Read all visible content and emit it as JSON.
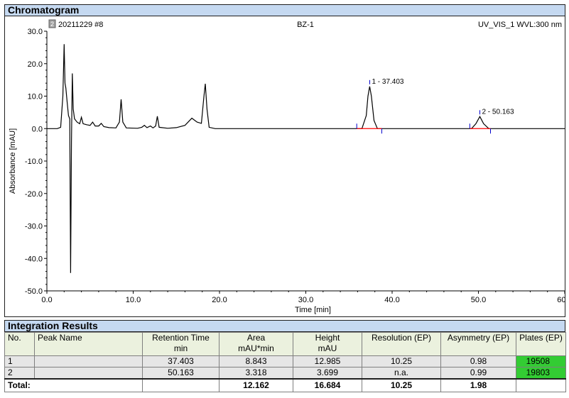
{
  "chromatogram": {
    "section_title": "Chromatogram",
    "header_left": "20211229 #8",
    "header_center": "BZ-1",
    "header_right": "UV_VIS_1 WVL:300 nm",
    "header_icon": "channel-icon"
  },
  "chart_data": {
    "type": "line",
    "title": "",
    "xlabel": "Time [min]",
    "ylabel": "Absorbance [mAU]",
    "xlim": [
      0,
      60
    ],
    "ylim": [
      -50,
      30
    ],
    "x_ticks": [
      "0.0",
      "10.0",
      "20.0",
      "30.0",
      "40.0",
      "50.0",
      "60.0"
    ],
    "y_ticks": [
      "30.0",
      "20.0",
      "10.0",
      "0.0",
      "-10.0",
      "-20.0",
      "-30.0",
      "-40.0",
      "-50.0"
    ],
    "grid": false,
    "line_color": "#000000",
    "baseline_color": "#ff0000",
    "marker_color": "#0000cc",
    "series": [
      {
        "points": [
          [
            0,
            0
          ],
          [
            1.2,
            0
          ],
          [
            1.6,
            0.4
          ],
          [
            1.85,
            10
          ],
          [
            2.0,
            26
          ],
          [
            2.1,
            14
          ],
          [
            2.2,
            12.5
          ],
          [
            2.35,
            8
          ],
          [
            2.5,
            4
          ],
          [
            2.65,
            3
          ],
          [
            2.75,
            -44.5
          ],
          [
            2.85,
            -4
          ],
          [
            2.95,
            17
          ],
          [
            3.05,
            6
          ],
          [
            3.2,
            3
          ],
          [
            3.5,
            2
          ],
          [
            3.8,
            1.5
          ],
          [
            4.0,
            3.5
          ],
          [
            4.2,
            1.5
          ],
          [
            4.6,
            1.2
          ],
          [
            5.0,
            1
          ],
          [
            5.3,
            2
          ],
          [
            5.6,
            0.8
          ],
          [
            6.0,
            0.8
          ],
          [
            6.3,
            1.6
          ],
          [
            6.6,
            0.6
          ],
          [
            7.2,
            0.3
          ],
          [
            8.0,
            0.2
          ],
          [
            8.4,
            2
          ],
          [
            8.6,
            9
          ],
          [
            8.8,
            2
          ],
          [
            9.2,
            0.2
          ],
          [
            10.5,
            0.1
          ],
          [
            11.0,
            0.4
          ],
          [
            11.3,
            1
          ],
          [
            11.6,
            0.3
          ],
          [
            12.0,
            0.8
          ],
          [
            12.3,
            0.2
          ],
          [
            12.6,
            0.8
          ],
          [
            12.8,
            3.8
          ],
          [
            13.0,
            0.4
          ],
          [
            14.0,
            0.1
          ],
          [
            15.0,
            0.3
          ],
          [
            16.0,
            1
          ],
          [
            16.8,
            3.2
          ],
          [
            17.4,
            2
          ],
          [
            17.9,
            1.6
          ],
          [
            18.2,
            10
          ],
          [
            18.35,
            13.8
          ],
          [
            18.55,
            6
          ],
          [
            18.8,
            0.4
          ],
          [
            19.5,
            0
          ],
          [
            25,
            0
          ],
          [
            30,
            0
          ],
          [
            35,
            0
          ],
          [
            36.5,
            0
          ],
          [
            37.0,
            4
          ],
          [
            37.2,
            10
          ],
          [
            37.4,
            12.985
          ],
          [
            37.6,
            10
          ],
          [
            37.9,
            2.5
          ],
          [
            38.3,
            0
          ],
          [
            45,
            0
          ],
          [
            49.2,
            0
          ],
          [
            49.7,
            1.5
          ],
          [
            50.163,
            3.699
          ],
          [
            50.6,
            1.5
          ],
          [
            51.2,
            0
          ],
          [
            55,
            0
          ],
          [
            60,
            0
          ]
        ]
      }
    ],
    "peaks": [
      {
        "number": "1",
        "retention": "37.403",
        "label": "1 - 37.403",
        "time": 37.403,
        "height": 12.985,
        "start": 35.9,
        "end": 38.8
      },
      {
        "number": "2",
        "retention": "50.163",
        "label": "2 - 50.163",
        "time": 50.163,
        "height": 3.699,
        "start": 49.0,
        "end": 51.4
      }
    ]
  },
  "integration": {
    "section_title": "Integration Results",
    "columns": [
      {
        "line1": "No.",
        "line2": ""
      },
      {
        "line1": "Peak Name",
        "line2": ""
      },
      {
        "line1": "Retention Time",
        "line2": "min"
      },
      {
        "line1": "Area",
        "line2": "mAU*min"
      },
      {
        "line1": "Height",
        "line2": "mAU"
      },
      {
        "line1": "Resolution (EP)",
        "line2": ""
      },
      {
        "line1": "Asymmetry (EP)",
        "line2": ""
      },
      {
        "line1": "Plates (EP)",
        "line2": ""
      }
    ],
    "rows": [
      {
        "no": "1",
        "peak_name": "",
        "retention": "37.403",
        "area": "8.843",
        "height": "12.985",
        "resolution": "10.25",
        "asymmetry": "0.98",
        "plates": "19508"
      },
      {
        "no": "2",
        "peak_name": "",
        "retention": "50.163",
        "area": "3.318",
        "height": "3.699",
        "resolution": "n.a.",
        "asymmetry": "0.99",
        "plates": "19803"
      }
    ],
    "total": {
      "label": "Total:",
      "area": "12.162",
      "height": "16.684",
      "resolution": "10.25",
      "asymmetry": "1.98"
    },
    "plates_highlight": "#33cc33"
  }
}
